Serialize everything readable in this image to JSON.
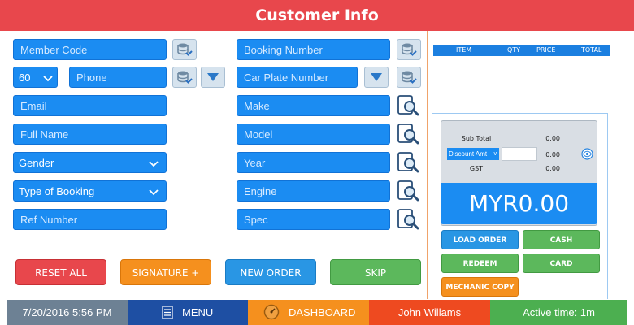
{
  "header": {
    "title": "Customer Info"
  },
  "left_form": {
    "member_code": "Member Code",
    "country_code": "60",
    "phone": "Phone",
    "email": "Email",
    "full_name": "Full Name",
    "gender": "Gender",
    "type_of_booking": "Type of Booking",
    "ref_number": "Ref Number"
  },
  "right_form": {
    "booking_number": "Booking Number",
    "car_plate_number": "Car Plate Number",
    "make": "Make",
    "model": "Model",
    "year": "Year",
    "engine": "Engine",
    "spec": "Spec"
  },
  "actions": {
    "reset_all": "RESET ALL",
    "signature": "SIGNATURE +",
    "new_order": "NEW ORDER",
    "skip": "SKIP"
  },
  "order_table": {
    "columns": [
      "ITEM",
      "QTY",
      "PRICE",
      "TOTAL"
    ]
  },
  "totals": {
    "sub_total_label": "Sub Total",
    "sub_total_value": "0.00",
    "discount_label": "Discount Amt",
    "discount_value": "0.00",
    "gst_label": "GST",
    "gst_value": "0.00",
    "grand_total": "MYR0.00"
  },
  "payment": {
    "load_order": "LOAD ORDER",
    "cash": "CASH",
    "redeem": "REDEEM",
    "card": "CARD",
    "mechanic_copy": "MECHANIC COPY"
  },
  "footer": {
    "datetime": "7/20/2016 5:56 PM",
    "menu": "MENU",
    "dashboard": "DASHBOARD",
    "user": "John Willams",
    "active_time": "Active time: 1m"
  },
  "colors": {
    "header": "#e8474c",
    "field_blue": "#1b8cf2",
    "reset": "#e8474c",
    "signature": "#f5901e",
    "new_order": "#2996e4",
    "skip": "#5cb85c"
  }
}
